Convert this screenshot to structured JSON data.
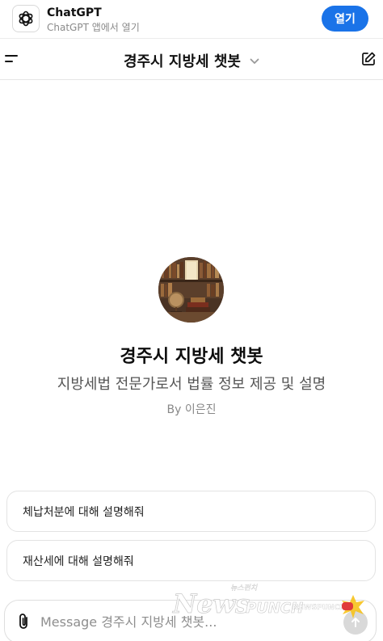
{
  "banner": {
    "app_name": "ChatGPT",
    "app_subtitle": "ChatGPT 앱에서 열기",
    "open_label": "열기",
    "icon": "openai-logo-icon",
    "accent": "#1a73e8"
  },
  "header": {
    "title": "경주시 지방세 챗봇",
    "menu_icon": "menu-icon",
    "dropdown_icon": "chevron-down-icon",
    "new_chat_icon": "edit-icon"
  },
  "gpt": {
    "name": "경주시 지방세 챗봇",
    "description": "지방세법 전문가로서 법률 정보 제공 및 설명",
    "author": "By 이은진",
    "avatar": "library-avatar"
  },
  "suggestions": [
    {
      "label": "체납처분에 대해 설명해줘"
    },
    {
      "label": "재산세에 대해 설명해줘"
    }
  ],
  "composer": {
    "placeholder": "Message 경주시 지방세 챗봇...",
    "attach_icon": "paperclip-icon",
    "send_icon": "send-icon"
  },
  "watermark": {
    "text": "News",
    "text_accent": "PUNCH",
    "small_text": "뉴스펀치",
    "brand": "NEWSPUNCH"
  }
}
